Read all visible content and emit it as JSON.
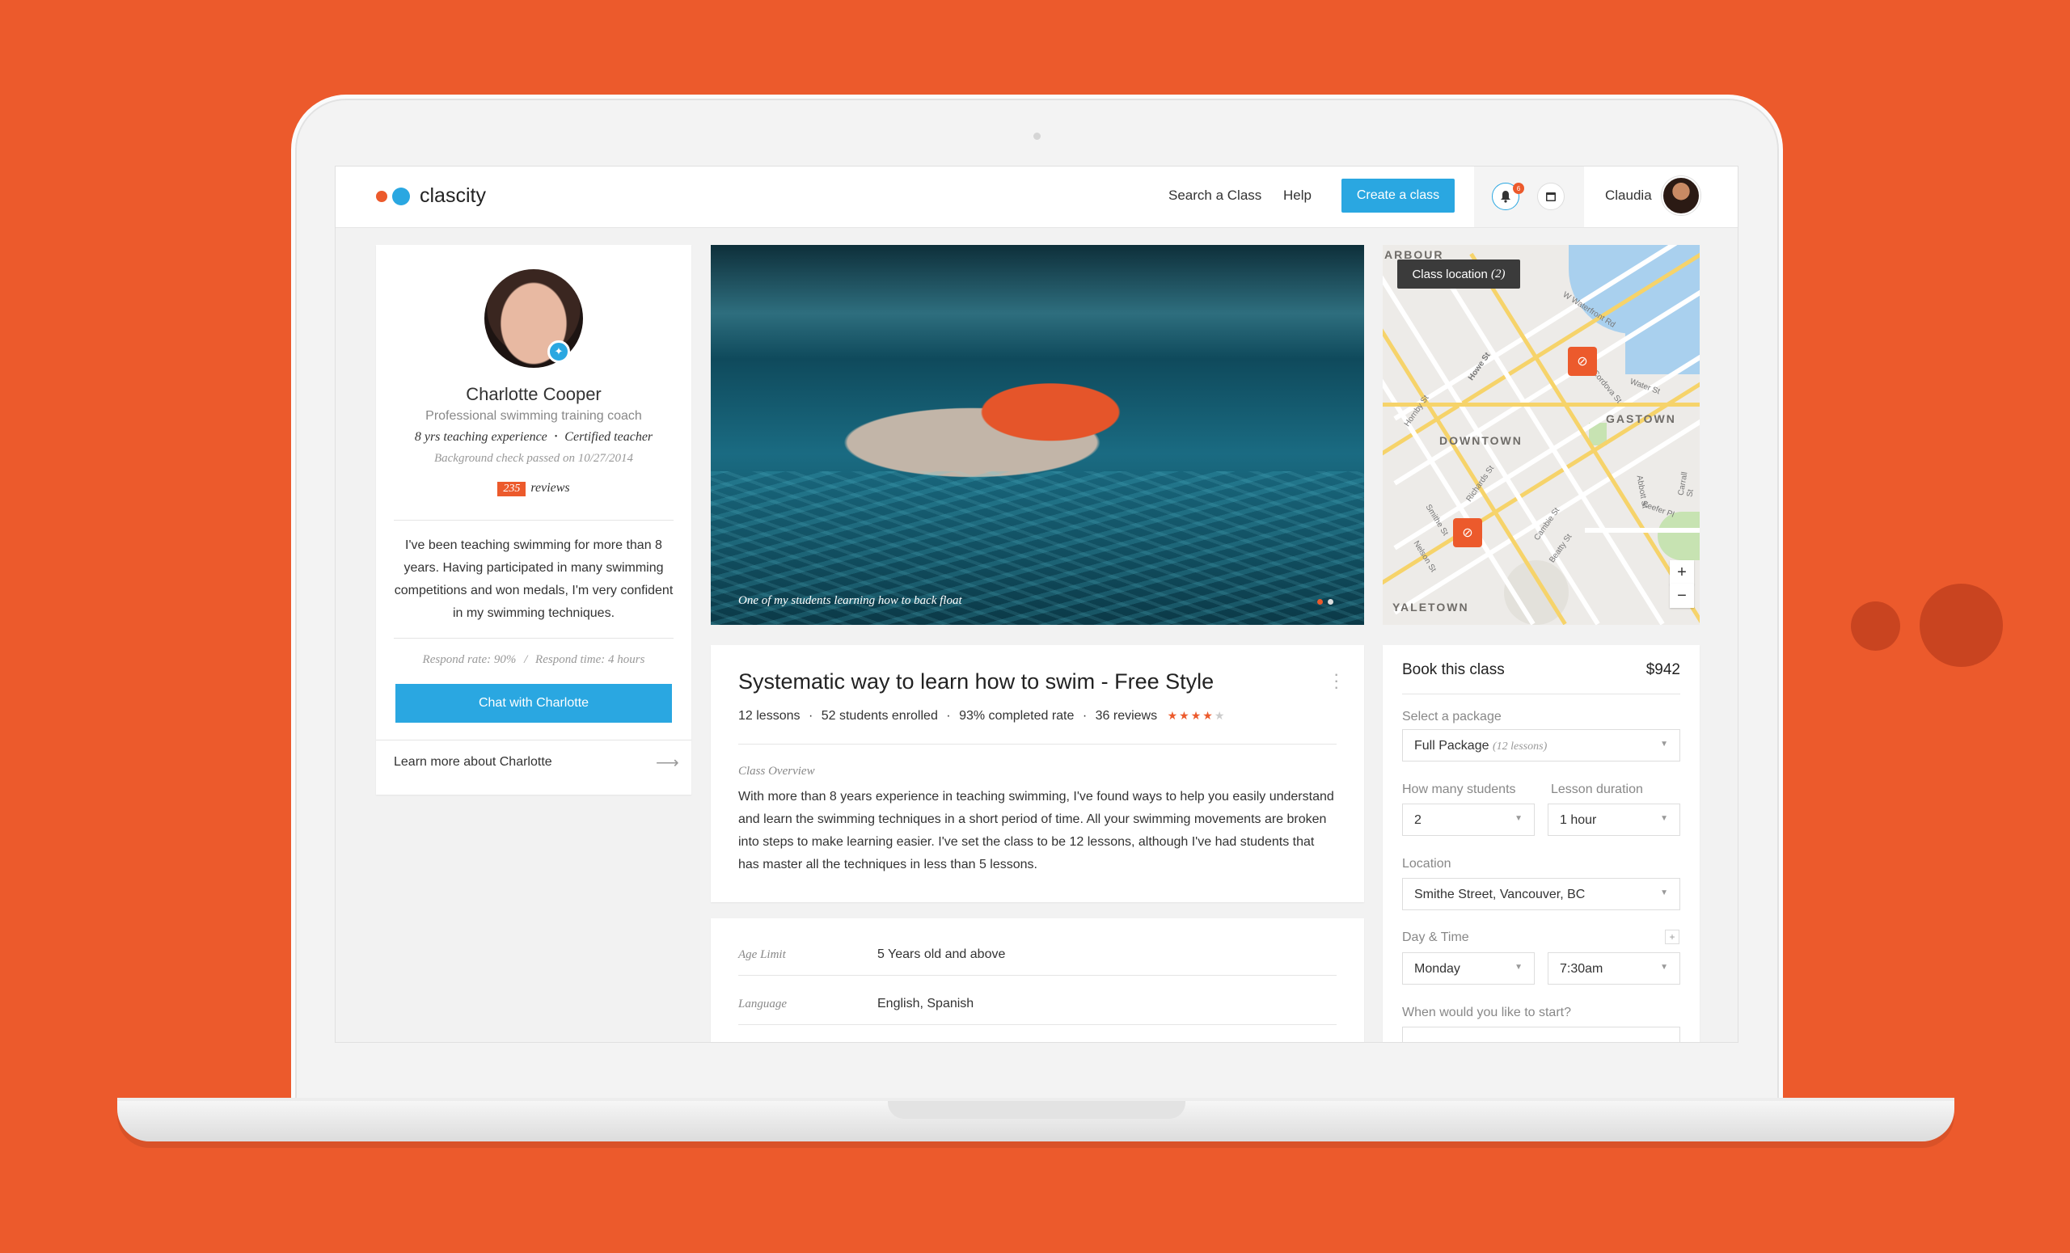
{
  "header": {
    "brand": "clascity",
    "nav": [
      "Search a Class",
      "Help"
    ],
    "create_button": "Create a class",
    "notification_count": "6",
    "user_name": "Claudia"
  },
  "profile": {
    "name": "Charlotte Cooper",
    "title": "Professional swimming training coach",
    "experience": "8 yrs teaching experience",
    "separator": "•",
    "certified": "Certified teacher",
    "background_check": "Background check passed on 10/27/2014",
    "review_count": "235",
    "reviews_word": "reviews",
    "bio": "I've been teaching swimming for more than 8 years. Having participated in many swimming competitions and won medals, I'm very confident in my swimming techniques.",
    "respond_rate": "Respond rate: 90%",
    "respond_sep": "/",
    "respond_time": "Respond time: 4 hours",
    "chat_button": "Chat with Charlotte",
    "learn_more": "Learn more about Charlotte"
  },
  "hero": {
    "caption": "One of my students learning how to back float",
    "slides": 2,
    "active_slide": 1
  },
  "map": {
    "tooltip": "Class location",
    "tooltip_count": "(2)",
    "areas": [
      "ARBOUR",
      "DOWNTOWN",
      "GASTOWN",
      "YALETOWN"
    ],
    "streets": [
      "W Waterfront Rd",
      "Howe St",
      "Water St",
      "Cordova St",
      "Hornby St",
      "Richards St",
      "Cambie St",
      "Beatty St",
      "Smithe St",
      "Nelson St",
      "Abbott St",
      "Keefer Pl",
      "Carrall St"
    ],
    "zoom_in": "+",
    "zoom_out": "−"
  },
  "class": {
    "title": "Systematic way to learn how to swim - Free Style",
    "lessons": "12 lessons",
    "enrolled": "52 students enrolled",
    "completed": "93% completed rate",
    "reviews": "36 reviews",
    "meta_sep": "·",
    "rating": 4,
    "rating_max": 5,
    "overview_label": "Class Overview",
    "overview_text": "With more than 8 years experience in teaching swimming, I've found ways to help you easily understand and learn the swimming techniques in a short period of time. All your swimming movements are broken into steps to make learning easier. I've set the class to be 12 lessons, although I've had students that has master all the techniques in less than 5 lessons."
  },
  "details": [
    {
      "label": "Age Limit",
      "value": "5 Years old and above"
    },
    {
      "label": "Language",
      "value": "English, Spanish"
    }
  ],
  "booking": {
    "title": "Book this class",
    "price": "$942",
    "package_label": "Select a package",
    "package_value": "Full Package",
    "package_hint": "(12 lessons)",
    "students_label": "How many students",
    "students_value": "2",
    "duration_label": "Lesson duration",
    "duration_value": "1 hour",
    "location_label": "Location",
    "location_value": "Smithe Street, Vancouver, BC",
    "daytime_label": "Day & Time",
    "day_value": "Monday",
    "time_value": "7:30am",
    "start_label": "When would you like to start?"
  },
  "colors": {
    "background": "#EC5A2C",
    "accent": "#2AA7E1",
    "brand_orange": "#EC5A2C"
  }
}
